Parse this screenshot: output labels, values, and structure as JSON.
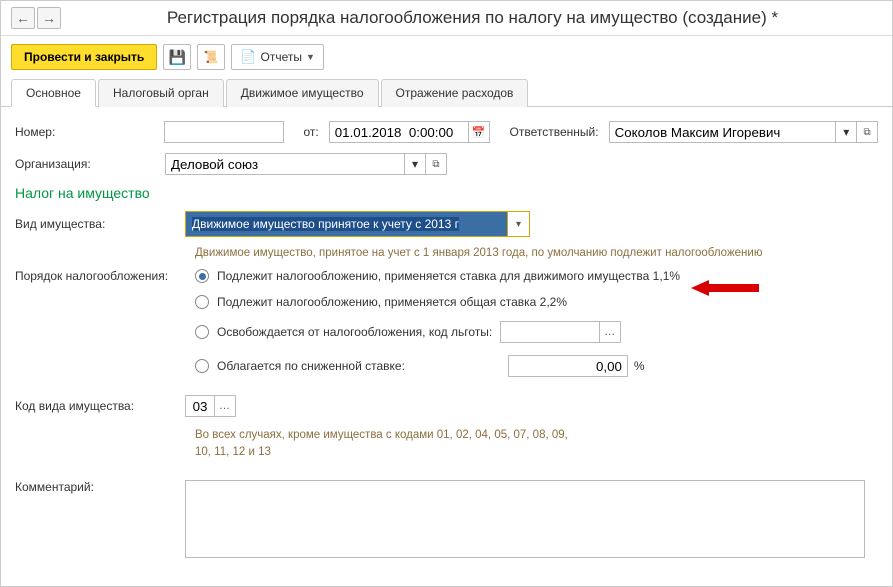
{
  "header": {
    "title": "Регистрация порядка налогообложения по налогу на имущество (создание) *"
  },
  "toolbar": {
    "post_and_close": "Провести и закрыть",
    "reports": "Отчеты"
  },
  "tabs": {
    "main": "Основное",
    "tax_authority": "Налоговый орган",
    "movable_property": "Движимое имущество",
    "expense_reflection": "Отражение расходов"
  },
  "form": {
    "number_label": "Номер:",
    "number_value": "",
    "from_label": "от:",
    "date_value": "01.01.2018  0:00:00",
    "responsible_label": "Ответственный:",
    "responsible_value": "Соколов Максим Игоревич",
    "organization_label": "Организация:",
    "organization_value": "Деловой союз",
    "section_title": "Налог на имущество",
    "property_type_label": "Вид имущества:",
    "property_type_value": "Движимое имущество принятое к учету с 2013 г",
    "property_hint": "Движимое имущество, принятое на учет с 1 января 2013 года, по умолчанию подлежит налогообложению",
    "tax_order_label": "Порядок налогообложения:",
    "radio1": "Подлежит налогообложению, применяется ставка для движимого имущества 1,1%",
    "radio2": "Подлежит налогообложению, применяется общая ставка 2,2%",
    "radio3": "Освобождается от налогообложения, код льготы:",
    "radio4": "Облагается по сниженной ставке:",
    "rate_value": "0,00",
    "pct": "%",
    "code_label": "Код вида имущества:",
    "code_value": "03",
    "code_hint": "Во всех случаях, кроме имущества с кодами 01, 02, 04, 05, 07, 08, 09, 10, 11, 12 и 13",
    "comment_label": "Комментарий:",
    "comment_value": ""
  }
}
